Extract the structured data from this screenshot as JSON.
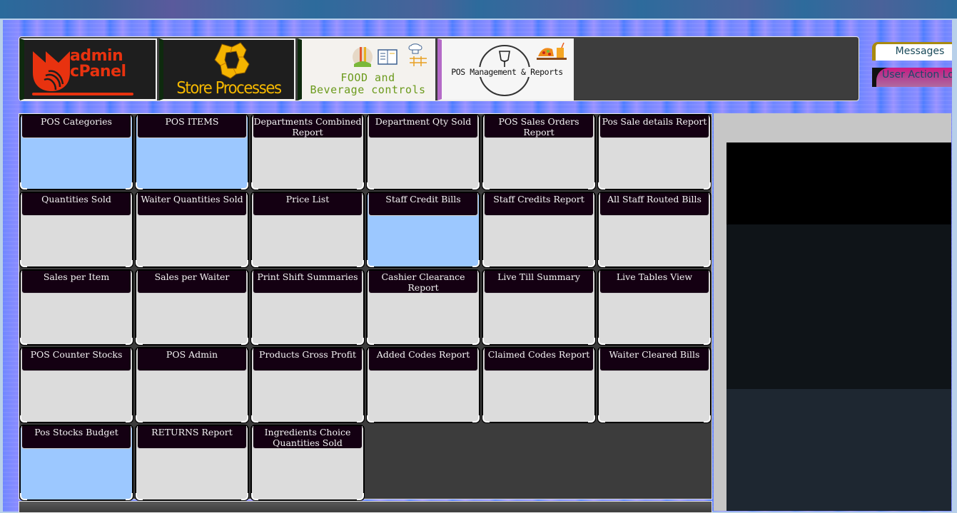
{
  "window": {
    "title": ""
  },
  "banner": {
    "tiles": [
      {
        "id": "admin",
        "label_line1": "admin",
        "label_line2": "cPanel",
        "icon": "admin-cpanel-logo"
      },
      {
        "id": "store",
        "label": "Store Processes",
        "icon": "store-processes-logo"
      },
      {
        "id": "fnb",
        "label_line1": "FOOD and",
        "label_line2": "Beverage controls",
        "icon": "food-beverage-logo"
      },
      {
        "id": "pos",
        "label": "POS Management & Reports",
        "icon": "pos-management-logo"
      }
    ]
  },
  "side_buttons": {
    "messages": "Messages",
    "user_action_log": "User Action Log"
  },
  "grid": {
    "columns": 6,
    "cells": [
      {
        "label": "POS Categories",
        "selected": true
      },
      {
        "label": "POS ITEMS",
        "selected": true
      },
      {
        "label": "Departments Combined Report",
        "selected": false
      },
      {
        "label": "Department Qty Sold",
        "selected": false
      },
      {
        "label": "POS Sales Orders Report",
        "selected": false
      },
      {
        "label": "Pos Sale details Report",
        "selected": false
      },
      {
        "label": "Quantities Sold",
        "selected": false
      },
      {
        "label": "Waiter Quantities Sold",
        "selected": false
      },
      {
        "label": "Price List",
        "selected": false
      },
      {
        "label": "Staff Credit Bills",
        "selected": true
      },
      {
        "label": "Staff Credits Report",
        "selected": false
      },
      {
        "label": "All Staff Routed Bills",
        "selected": false
      },
      {
        "label": "Sales per Item",
        "selected": false
      },
      {
        "label": "Sales per Waiter",
        "selected": false
      },
      {
        "label": "Print Shift Summaries",
        "selected": false
      },
      {
        "label": "Cashier Clearance Report",
        "selected": false
      },
      {
        "label": "Live Till Summary",
        "selected": false
      },
      {
        "label": "Live Tables View",
        "selected": false
      },
      {
        "label": "POS Counter Stocks",
        "selected": false
      },
      {
        "label": "POS Admin",
        "selected": false
      },
      {
        "label": "Products Gross Profit",
        "selected": false
      },
      {
        "label": "Added Codes Report",
        "selected": false
      },
      {
        "label": "Claimed Codes Report",
        "selected": false
      },
      {
        "label": "Waiter Cleared Bills",
        "selected": false
      },
      {
        "label": "Pos Stocks Budget",
        "selected": true
      },
      {
        "label": "RETURNS Report",
        "selected": false
      },
      {
        "label": "Ingredients Choice Quantities Sold",
        "selected": false
      }
    ]
  },
  "colors": {
    "cell_selected": "#9cc8ff",
    "cell_default": "#dcdcdc",
    "cell_header": "#140012",
    "admin_red": "#e8320f",
    "store_gold": "#f5b800",
    "fnb_green": "#6b9a1c"
  }
}
